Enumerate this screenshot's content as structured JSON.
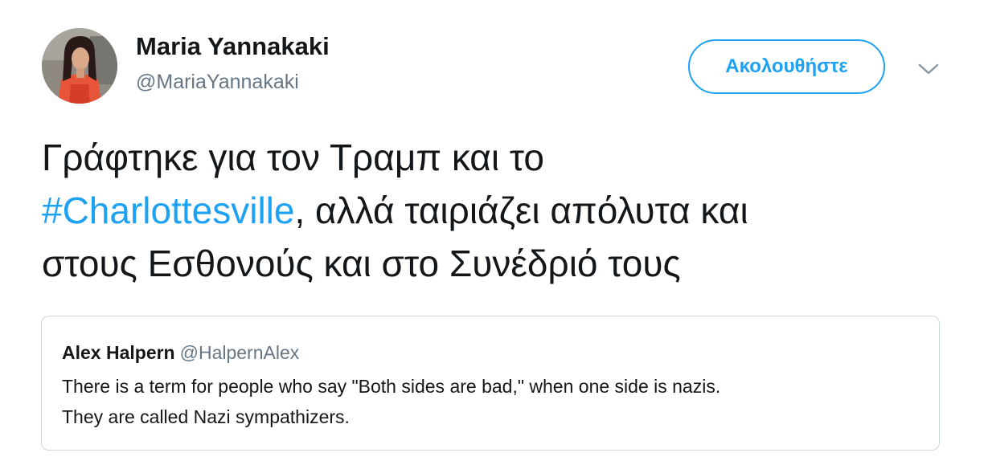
{
  "tweet": {
    "author": {
      "name": "Maria Yannakaki",
      "handle": "@MariaYannakaki"
    },
    "follow_label": "Ακολουθήστε",
    "text": {
      "line1": "Γράφτηκε για τον Τραμπ και το",
      "hashtag": "#Charlottesville",
      "line2_rest": ", αλλά ταιριάζει απόλυτα και",
      "line3": "στους Εσθονούς και στο Συνέδριό τους"
    },
    "quoted": {
      "name": "Alex Halpern",
      "handle": "@HalpernAlex",
      "line1": "There is a term for people who say \"Both sides are bad,\" when one side is nazis.",
      "line2": "They are called Nazi sympathizers."
    }
  },
  "icons": {
    "avatar": "avatar-photo",
    "caret": "chevron-down-icon"
  },
  "colors": {
    "accent": "#1da1f2",
    "text_primary": "#14171a",
    "text_secondary": "#657786",
    "border": "#ccd6dd"
  }
}
